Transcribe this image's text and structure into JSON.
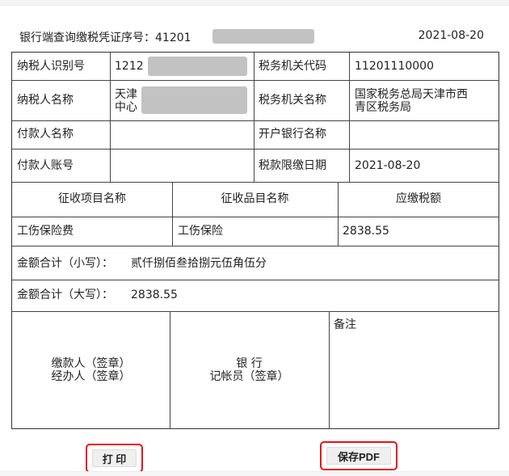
{
  "header": {
    "serial_label": "银行端查询缴税凭证序号：41201",
    "date": "2021-08-20"
  },
  "rows": {
    "taxpayer_id_label": "纳税人识别号",
    "taxpayer_id_value": "1212",
    "tax_office_code_label": "税务机关代码",
    "tax_office_code_value": "11201110000",
    "taxpayer_name_label": "纳税人名称",
    "taxpayer_name_value_line1": "天津",
    "taxpayer_name_value_line2": "中心",
    "tax_office_name_label": "税务机关名称",
    "tax_office_name_value_line1": "国家税务总局天津市西",
    "tax_office_name_value_line2": "青区税务局",
    "payer_name_label": "付款人名称",
    "payer_name_value": "",
    "bank_name_label": "开户银行名称",
    "bank_name_value": "",
    "payer_account_label": "付款人账号",
    "payer_account_value": "",
    "deadline_label": "税款限缴日期",
    "deadline_value": "2021-08-20"
  },
  "items_table": {
    "headers": [
      "征收项目名称",
      "征收品目名称",
      "应缴税额"
    ],
    "rows": [
      [
        "工伤保险费",
        "工伤保险",
        "2838.55"
      ]
    ]
  },
  "totals": {
    "small_label": "金额合计（小写）：",
    "small_value": "贰仟捌佰叁拾捌元伍角伍分",
    "big_label": "金额合计（大写）：",
    "big_value": "2838.55"
  },
  "signature": {
    "payer_line1": "缴款人（签章）",
    "payer_line2": "经办人（签章）",
    "bank_line1": "银 行",
    "bank_line2": "记帐员（签章）",
    "remarks_label": "备注"
  },
  "buttons": {
    "print_label": "打 印",
    "save_pdf_label": "保存PDF"
  },
  "colors": {
    "highlight_border": "#e5141c",
    "redaction": "#c2c2c2"
  }
}
